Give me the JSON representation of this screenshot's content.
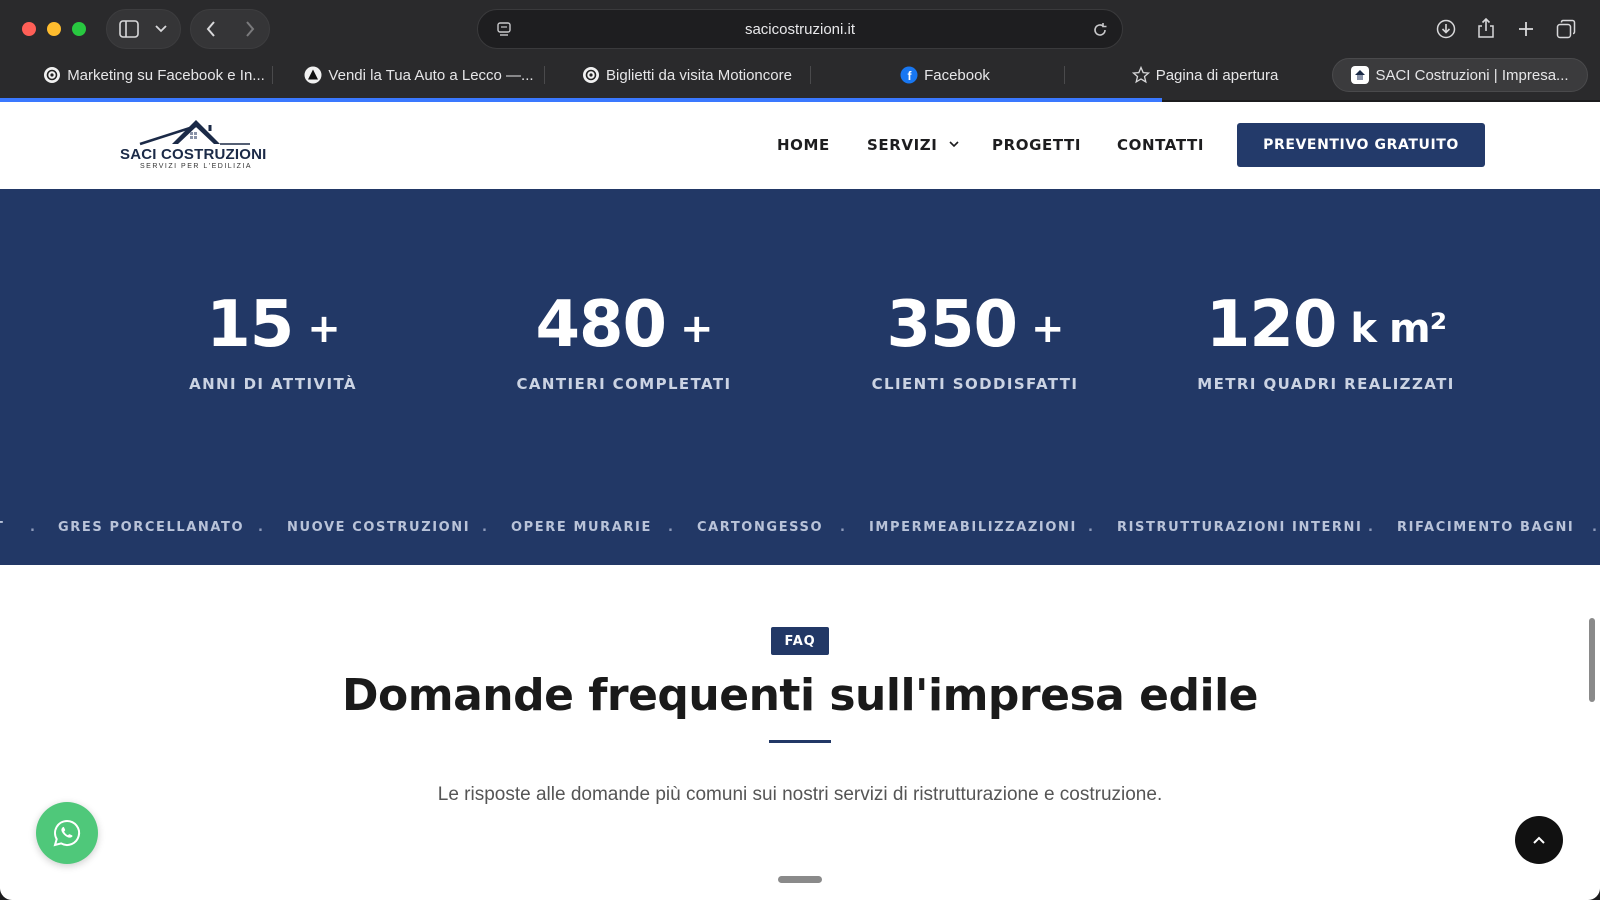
{
  "browser": {
    "url": "sacicostruzioni.it",
    "tabs": [
      {
        "label": "Marketing su Facebook e In...",
        "icon": "openai-icon"
      },
      {
        "label": "Vendi la Tua Auto a Lecco —...",
        "icon": "triangle-logo-icon"
      },
      {
        "label": "Biglietti da visita Motioncore",
        "icon": "openai-icon"
      },
      {
        "label": "Facebook",
        "icon": "facebook-icon"
      },
      {
        "label": "Pagina di apertura",
        "icon": "star-icon"
      },
      {
        "label": "SACI Costruzioni | Impresa...",
        "icon": "site-favicon"
      }
    ],
    "active_tab": 5
  },
  "header": {
    "logo_name": "SACI COSTRUZIONI",
    "logo_tagline": "SERVIZI PER L'EDILIZIA",
    "nav": {
      "home": "HOME",
      "servizi": "SERVIZI",
      "progetti": "PROGETTI",
      "contatti": "CONTATTI"
    },
    "cta": "PREVENTIVO GRATUITO"
  },
  "stats": [
    {
      "value": "15",
      "suffix": "+",
      "label": "ANNI DI ATTIVITÀ"
    },
    {
      "value": "480",
      "suffix": "+",
      "label": "CANTIERI COMPLETATI"
    },
    {
      "value": "350",
      "suffix": "+",
      "label": "CLIENTI SODDISFATTI"
    },
    {
      "value": "120",
      "suffix": "k m²",
      "label": "METRI QUADRI REALIZZATI"
    }
  ],
  "ticker": {
    "leading_fragment": "T",
    "items": [
      "GRES PORCELLANATO",
      "NUOVE COSTRUZIONI",
      "OPERE MURARIE",
      "CARTONGESSO",
      "IMPERMEABILIZZAZIONI",
      "RISTRUTTURAZIONI INTERNI",
      "RIFACIMENTO BAGNI"
    ],
    "separator": "."
  },
  "faq": {
    "badge": "FAQ",
    "title": "Domande frequenti sull'impresa edile",
    "subtitle": "Le risposte alle domande più comuni sui nostri servizi di ristrutturazione e costruzione."
  },
  "colors": {
    "brand_navy": "#223866",
    "whatsapp_green": "#4fc87a"
  }
}
